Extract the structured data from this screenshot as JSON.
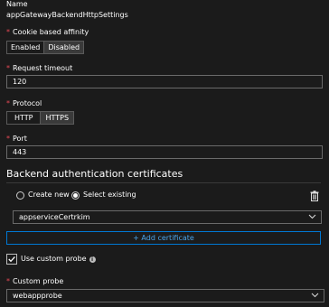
{
  "name": {
    "label": "Name",
    "value": "appGatewayBackendHttpSettings"
  },
  "cookie_affinity": {
    "label": "Cookie based affinity",
    "options": [
      "Enabled",
      "Disabled"
    ],
    "selected": "Disabled"
  },
  "request_timeout": {
    "label": "Request timeout",
    "value": "120"
  },
  "protocol": {
    "label": "Protocol",
    "options": [
      "HTTP",
      "HTTPS"
    ],
    "selected": "HTTPS"
  },
  "port": {
    "label": "Port",
    "value": "443"
  },
  "backend_auth": {
    "heading": "Backend authentication certificates",
    "radio_create": "Create new",
    "radio_select": "Select existing",
    "selected_radio": "Select existing",
    "certificate_value": "appserviceCertrkim",
    "add_certificate": "+ Add certificate"
  },
  "custom_probe_toggle": {
    "label": "Use custom probe",
    "checked": true
  },
  "custom_probe": {
    "label": "Custom probe",
    "value": "webappprobe"
  },
  "colors": {
    "background": "#1b1b1b",
    "accent": "#0078d4",
    "required": "#e74856"
  }
}
